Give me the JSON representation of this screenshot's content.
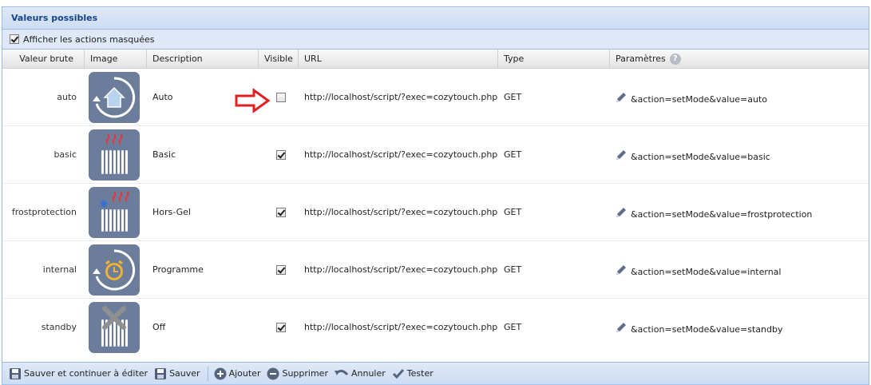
{
  "panel": {
    "title": "Valeurs possibles"
  },
  "options": {
    "show_hidden_label": "Afficher les actions masquées",
    "show_hidden_checked": true
  },
  "columns": {
    "raw": "Valeur brute",
    "image": "Image",
    "description": "Description",
    "visible": "Visible",
    "url": "URL",
    "type": "Type",
    "params": "Paramètres"
  },
  "rows": [
    {
      "raw": "auto",
      "icon": "auto-home-icon",
      "description": "Auto",
      "visible": false,
      "url": "http://localhost/script/?exec=cozytouch.php&pl...",
      "type": "GET",
      "params": "&action=setMode&value=auto"
    },
    {
      "raw": "basic",
      "icon": "radiator-heat-icon",
      "description": "Basic",
      "visible": true,
      "url": "http://localhost/script/?exec=cozytouch.php&pl...",
      "type": "GET",
      "params": "&action=setMode&value=basic"
    },
    {
      "raw": "frostprotection",
      "icon": "radiator-frost-icon",
      "description": "Hors-Gel",
      "visible": true,
      "url": "http://localhost/script/?exec=cozytouch.php&pl...",
      "type": "GET",
      "params": "&action=setMode&value=frostprotection"
    },
    {
      "raw": "internal",
      "icon": "alarm-clock-icon",
      "description": "Programme",
      "visible": true,
      "url": "http://localhost/script/?exec=cozytouch.php&pl...",
      "type": "GET",
      "params": "&action=setMode&value=internal"
    },
    {
      "raw": "standby",
      "icon": "radiator-off-icon",
      "description": "Off",
      "visible": true,
      "url": "http://localhost/script/?exec=cozytouch.php&pl...",
      "type": "GET",
      "params": "&action=setMode&value=standby"
    }
  ],
  "footer": {
    "save_continue": "Sauver et continuer à éditer",
    "save": "Sauver",
    "add": "Ajouter",
    "delete": "Supprimer",
    "cancel": "Annuler",
    "test": "Tester"
  },
  "colors": {
    "header_bg": "#dfe8f6",
    "title": "#15428b",
    "tile": "#6c7d9c",
    "arrow": "#e02020"
  }
}
